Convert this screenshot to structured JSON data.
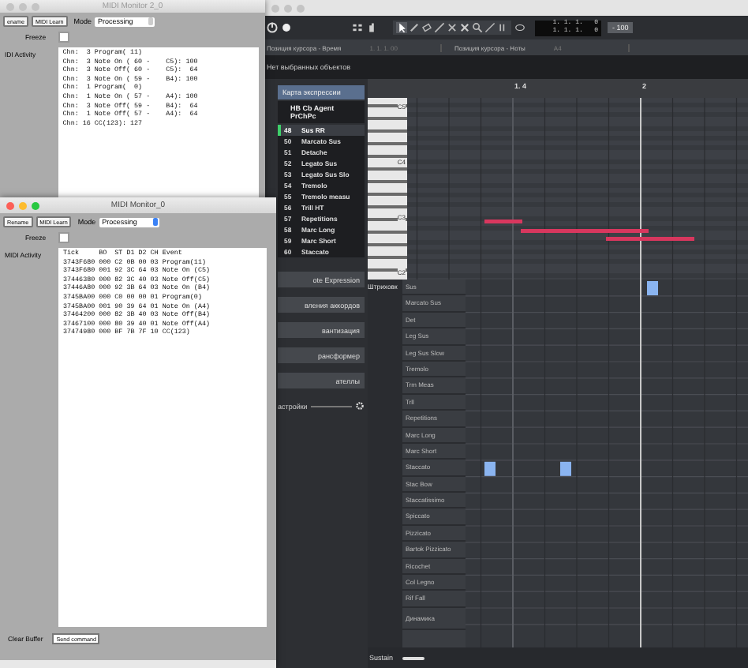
{
  "monitor_back": {
    "title": "MIDI Monitor 2_0",
    "buttons": [
      "ename",
      "MIDI Learn"
    ],
    "mode_label": "Mode",
    "mode_value": "Processing",
    "freeze_label": "Freeze",
    "freeze_checked": false,
    "activity_label": "IDI Activity",
    "log": [
      "Chn:  3 Program( 11)",
      "Chn:  3 Note On ( 60 -    C5): 100",
      "Chn:  3 Note Off( 60 -    C5):  64",
      "Chn:  3 Note On ( 59 -    B4): 100",
      "Chn:  1 Program(  0)",
      "Chn:  1 Note On ( 57 -    A4): 100",
      "Chn:  3 Note Off( 59 -    B4):  64",
      "Chn:  1 Note Off( 57 -    A4):  64",
      "Chn: 16 CC(123): 127"
    ]
  },
  "monitor_front": {
    "title": "MIDI Monitor_0",
    "buttons": [
      "Rename",
      "MIDI Learn"
    ],
    "mode_label": "Mode",
    "mode_value": "Processing",
    "freeze_label": "Freeze",
    "freeze_checked": false,
    "activity_label": "MIDI Activity",
    "log": [
      "Tick     BO  ST D1 D2 CH Event",
      "3743F680 000 C2 0B 00 03 Program(11)",
      "3743F680 001 92 3C 64 03 Note On (C5)",
      "37446380 000 82 3C 40 03 Note Off(C5)",
      "37446A80 000 92 3B 64 03 Note On (B4)",
      "3745BA00 000 C0 00 00 01 Program(0)",
      "3745BA00 001 90 39 64 01 Note On (A4)",
      "37464200 000 82 3B 40 03 Note Off(B4)",
      "37467100 000 80 39 40 01 Note Off(A4)",
      "37474980 000 BF 7B 7F 10 CC(123)"
    ],
    "clear_label": "Clear Buffer",
    "send_button": "Send command"
  },
  "editor": {
    "counters": [
      "1. 1. 1.   0",
      "1. 1. 1.   0"
    ],
    "zoom": "- 100",
    "info": [
      {
        "label": "Позиция курсора - Время",
        "value": "1. 1. 1. 00"
      },
      {
        "label": "Позиция курсора - Ноты",
        "value": "A4"
      }
    ],
    "selection": "Нет выбранных объектов",
    "inspector": {
      "header": "Карта экспрессии",
      "map": "HB Cb Agent PrChPc",
      "articulations": [
        {
          "key": "48",
          "name": "Sus RR",
          "selected": true
        },
        {
          "key": "50",
          "name": "Marcato Sus",
          "selected": false
        },
        {
          "key": "51",
          "name": "Detache",
          "selected": false
        },
        {
          "key": "52",
          "name": "Legato Sus",
          "selected": false
        },
        {
          "key": "53",
          "name": "Legato Sus Slo",
          "selected": false
        },
        {
          "key": "54",
          "name": "Tremolo",
          "selected": false
        },
        {
          "key": "55",
          "name": "Tremolo measu",
          "selected": false
        },
        {
          "key": "56",
          "name": "Trill HT",
          "selected": false
        },
        {
          "key": "57",
          "name": "Repetitions",
          "selected": false
        },
        {
          "key": "58",
          "name": "Marc Long",
          "selected": false
        },
        {
          "key": "59",
          "name": "Marc Short",
          "selected": false
        },
        {
          "key": "60",
          "name": "Staccato",
          "selected": false
        }
      ],
      "sections": [
        "ote Expression",
        "вления аккордов",
        "вантизация",
        "рансформер",
        "ателлы"
      ],
      "settings": "астройки"
    },
    "ruler": [
      "1. 4",
      "2"
    ],
    "keys": [
      "C5",
      "C4",
      "C3",
      "C2"
    ],
    "lane_title": "Штриховк",
    "lanes": [
      "Sus",
      "Marcato Sus",
      "Det",
      "Leg Sus",
      "Leg Sus Slow",
      "Tremolo",
      "Trm Meas",
      "Trll",
      "Repetitions",
      "Marc Long",
      "Marc Short",
      "Staccato",
      "Stac Bow",
      "Staccatissimo",
      "Spiccato",
      "Pizzicato",
      "Bartok Pizzicato",
      "Ricochet",
      "Col Legno",
      "Rif Fall",
      "Динамика"
    ],
    "controller": "Sustain"
  }
}
